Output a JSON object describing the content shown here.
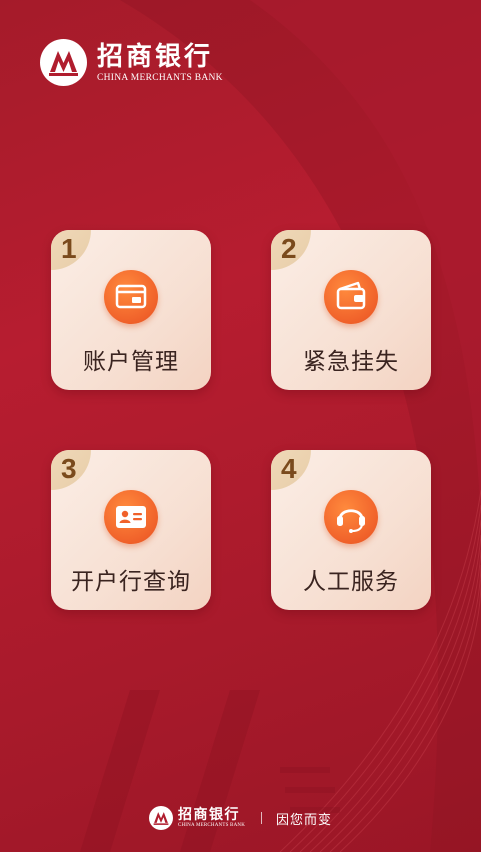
{
  "brand": {
    "name_cn": "招商银行",
    "name_en": "CHINA MERCHANTS BANK"
  },
  "cards": [
    {
      "number": "1",
      "label": "账户管理",
      "icon": "card-icon"
    },
    {
      "number": "2",
      "label": "紧急挂失",
      "icon": "wallet-icon"
    },
    {
      "number": "3",
      "label": "开户行查询",
      "icon": "id-card-icon"
    },
    {
      "number": "4",
      "label": "人工服务",
      "icon": "headset-icon"
    }
  ],
  "footer": {
    "name_cn": "招商银行",
    "name_en": "CHINA MERCHANTS BANK",
    "slogan": "因您而变"
  },
  "colors": {
    "background": "#a51b2a",
    "card": "#f7e0d3",
    "icon_orange": "#f0612a",
    "number_badge": "#efd8b8",
    "number_text": "#7a4a1c"
  }
}
